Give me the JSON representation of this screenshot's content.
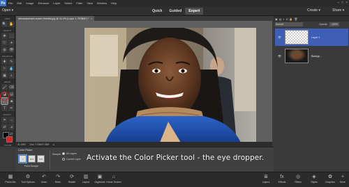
{
  "app": {
    "logo": "Ps"
  },
  "menubar": {
    "items": [
      "File",
      "Edit",
      "Image",
      "Enhance",
      "Layer",
      "Select",
      "Filter",
      "View",
      "Window",
      "Help"
    ],
    "window_controls": [
      "–",
      "□",
      "×"
    ]
  },
  "modebar": {
    "open_label": "Open ▾",
    "modes": [
      "Quick",
      "Guided",
      "Expert"
    ],
    "active_mode": "Expert",
    "create_label": "Create ▾",
    "share_label": "Share ▾"
  },
  "toolbox": {
    "sections": {
      "view": "VIEW",
      "select": "SELECT",
      "enhance": "ENHANCE",
      "draw": "DRAW",
      "modify": "MODIFY",
      "color": "COLOR"
    },
    "view_tools": [
      [
        "zoom-icon",
        "🔍"
      ],
      [
        "hand-icon",
        "✋"
      ]
    ],
    "select_tools": [
      [
        "move-icon",
        "✥"
      ],
      [
        "marquee-icon",
        "⬚"
      ],
      [
        "lasso-icon",
        "➰"
      ],
      [
        "magic-wand-icon",
        "✦"
      ],
      [
        "quick-selection-icon",
        "◍"
      ],
      [
        "eye-icon",
        "👁"
      ]
    ],
    "enhance_tools": [
      [
        "spot-healing-icon",
        "✚"
      ],
      [
        "smart-brush-icon",
        "✎"
      ],
      [
        "clone-stamp-icon",
        "⚐"
      ],
      [
        "blur-icon",
        "💧"
      ],
      [
        "sponge-icon",
        "▣"
      ],
      [
        "dodge-icon",
        "◐"
      ]
    ],
    "draw_tools": [
      [
        "brush-icon",
        "🖌"
      ],
      [
        "eraser-icon",
        "⌫"
      ],
      [
        "paint-bucket-icon",
        "◪"
      ],
      [
        "gradient-icon",
        "▤"
      ],
      [
        "color-picker-icon",
        "⁄"
      ],
      [
        "shape-icon",
        "■"
      ],
      [
        "type-icon",
        "T"
      ],
      [
        "pencil-icon",
        "✏"
      ]
    ],
    "modify_tools": [
      [
        "crop-icon",
        "⌗"
      ],
      [
        "recompose-icon",
        "⇔"
      ],
      [
        "content-aware-move-icon",
        "⇄"
      ],
      [
        "straighten-icon",
        "⦨"
      ]
    ]
  },
  "document": {
    "tab_title": "africanwomanLondon-Hohalis.jpg @ 41.2% (Layer 1, RGB/8*) *",
    "close": "×"
  },
  "statusbar": {
    "zoom": "41.18%",
    "doc": "Doc: 7.03M/7.03M",
    "arrow": "▸"
  },
  "right_panel": {
    "blend_mode": "Normal",
    "opacity_label": "Opacity:",
    "opacity_value": "100%",
    "layers": [
      {
        "name": "Layer 1",
        "active": true,
        "kind": "transparent"
      },
      {
        "name": "Backgr...",
        "active": false,
        "kind": "photo"
      }
    ]
  },
  "tool_options": {
    "title": "Color Picker",
    "sample_buttons": [
      "•",
      "3×3",
      "5×5"
    ],
    "sample_label": "Point Sample",
    "sample_header": "Sample:",
    "radios": [
      {
        "label": "All Layers",
        "on": true
      },
      {
        "label": "Current Layer",
        "on": false
      }
    ]
  },
  "caption": "Activate the Color Picker tool - the eye dropper.",
  "taskbar": {
    "left": [
      {
        "name": "photo-bin",
        "label": "Photo Bin",
        "icon": "▦"
      },
      {
        "name": "tool-options",
        "label": "Tool Options",
        "icon": "⚙"
      },
      {
        "name": "undo",
        "label": "Undo",
        "icon": "↶"
      },
      {
        "name": "redo",
        "label": "Redo",
        "icon": "↷"
      },
      {
        "name": "rotate",
        "label": "Rotate",
        "icon": "⟳"
      },
      {
        "name": "layout",
        "label": "Layout",
        "icon": "▥"
      },
      {
        "name": "organizer",
        "label": "Organizer",
        "icon": "▣"
      },
      {
        "name": "home-screen",
        "label": "Home Screen",
        "icon": "⌂"
      }
    ],
    "right": [
      {
        "name": "layers",
        "label": "Layers",
        "icon": "≣"
      },
      {
        "name": "effects",
        "label": "Effects",
        "icon": "fx"
      },
      {
        "name": "filters",
        "label": "Filters",
        "icon": "◎"
      },
      {
        "name": "styles",
        "label": "Styles",
        "icon": "◈"
      },
      {
        "name": "graphics",
        "label": "Graphics",
        "icon": "✿"
      },
      {
        "name": "more",
        "label": "More",
        "icon": "+"
      }
    ]
  },
  "colors": {
    "accent": "#3e5fb5",
    "highlight": "#e01c1c",
    "fg_swatch": "#000000",
    "bg_swatch": "#e02020"
  }
}
